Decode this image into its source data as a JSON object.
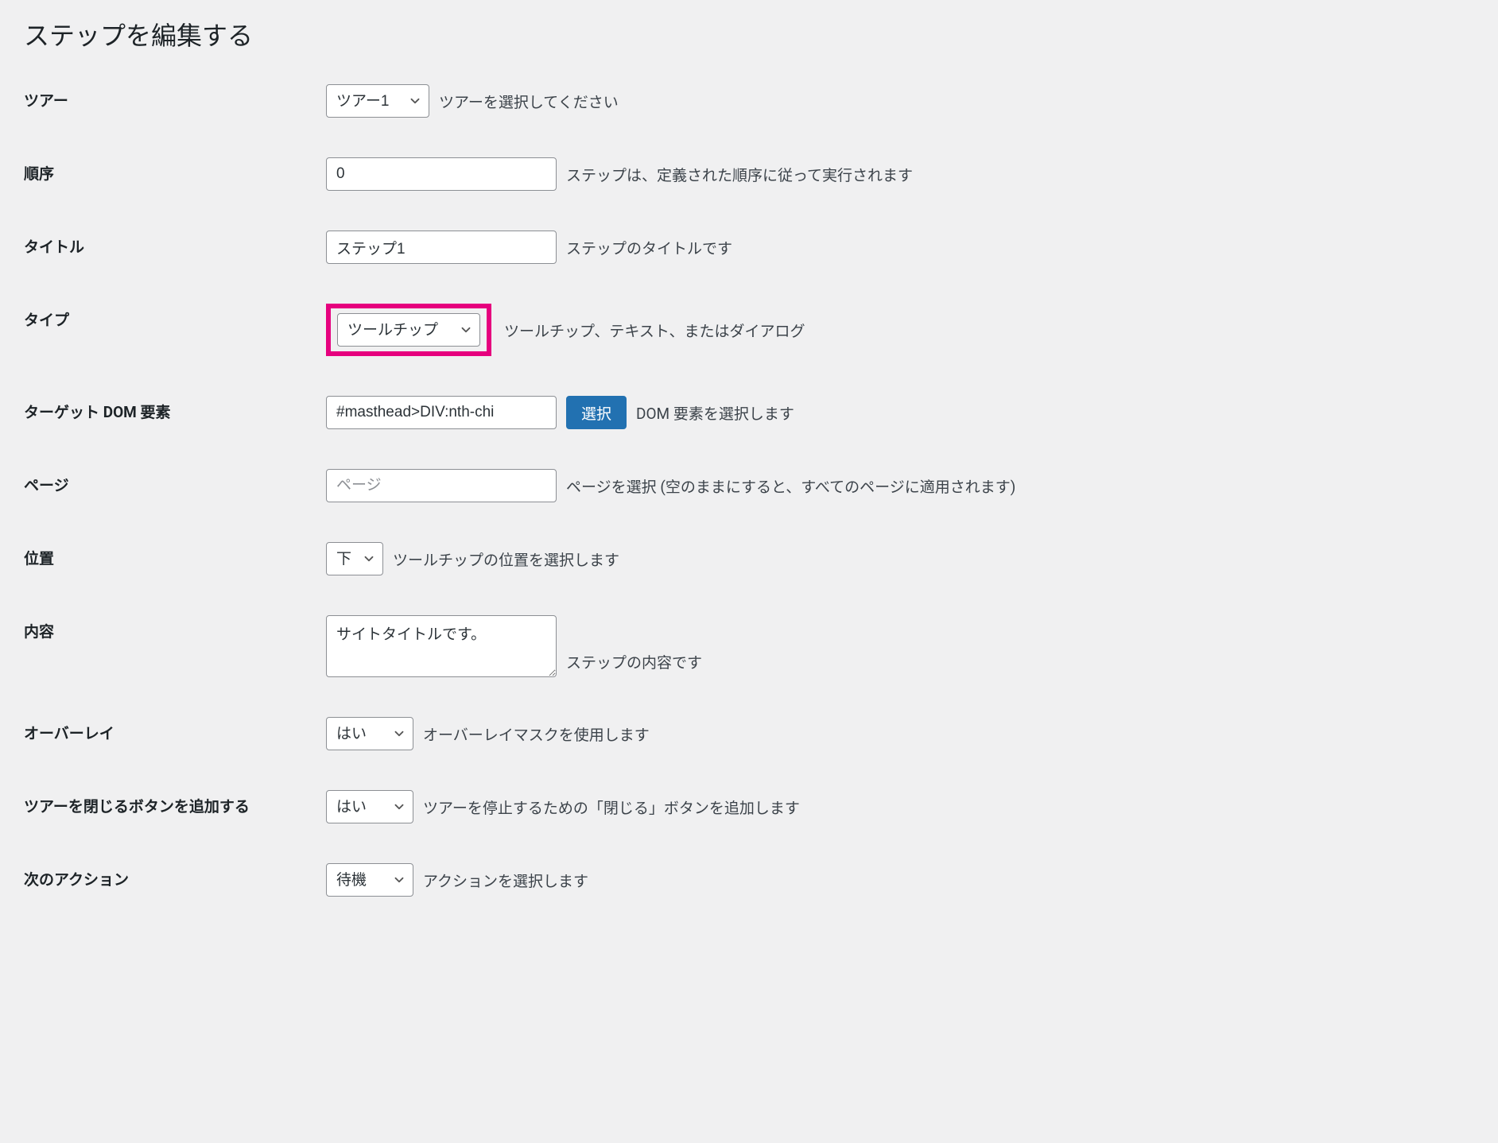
{
  "page": {
    "title": "ステップを編集する"
  },
  "fields": {
    "tour": {
      "label": "ツアー",
      "value": "ツアー1",
      "help": "ツアーを選択してください"
    },
    "order": {
      "label": "順序",
      "value": "0",
      "help": "ステップは、定義された順序に従って実行されます"
    },
    "title": {
      "label": "タイトル",
      "value": "ステップ1",
      "help": "ステップのタイトルです"
    },
    "type": {
      "label": "タイプ",
      "value": "ツールチップ",
      "help": "ツールチップ、テキスト、またはダイアログ"
    },
    "target": {
      "label": "ターゲット DOM 要素",
      "value": "#masthead>DIV:nth-chi",
      "button": "選択",
      "help": "DOM 要素を選択します"
    },
    "page_select": {
      "label": "ページ",
      "placeholder": "ページ",
      "value": "",
      "help": "ページを選択 (空のままにすると、すべてのページに適用されます)"
    },
    "position": {
      "label": "位置",
      "value": "下",
      "help": "ツールチップの位置を選択します"
    },
    "content": {
      "label": "内容",
      "value": "サイトタイトルです。",
      "help": "ステップの内容です"
    },
    "overlay": {
      "label": "オーバーレイ",
      "value": "はい",
      "help": "オーバーレイマスクを使用します"
    },
    "close_button": {
      "label": "ツアーを閉じるボタンを追加する",
      "value": "はい",
      "help": "ツアーを停止するための「閉じる」ボタンを追加します"
    },
    "next_action": {
      "label": "次のアクション",
      "value": "待機",
      "help": "アクションを選択します"
    }
  }
}
